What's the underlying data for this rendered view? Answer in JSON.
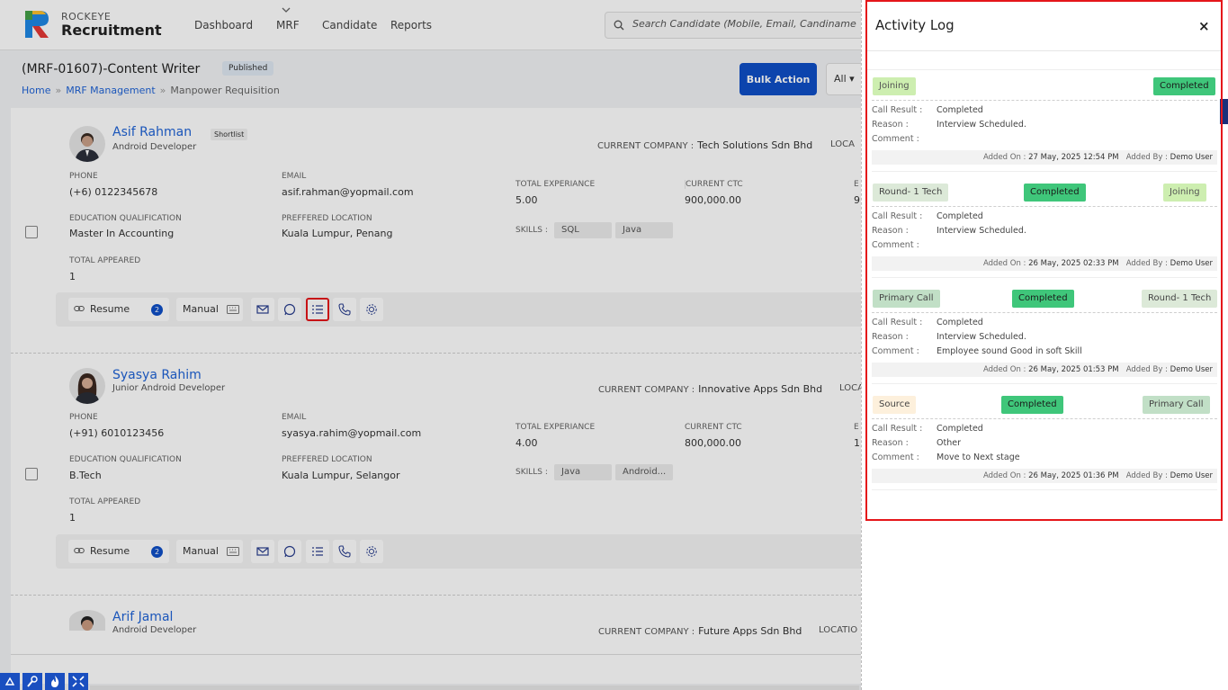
{
  "header": {
    "brand_top": "ROCKEYE",
    "brand_name": "Recruitment",
    "nav": [
      "Dashboard",
      "MRF",
      "Candidate",
      "Reports"
    ],
    "search_placeholder": "Search Candidate (Mobile, Email, Candiname"
  },
  "page": {
    "title": "(MRF-01607)-Content Writer",
    "status": "Published",
    "breadcrumb": [
      "Home",
      "MRF Management",
      "Manpower Requisition"
    ],
    "bulk_action": "Bulk Action",
    "filter": "All"
  },
  "labels": {
    "phone": "PHONE",
    "email": "EMAIL",
    "total_exp": "TOTAL EXPERIANCE",
    "ctc": "CURRENT CTC",
    "edu": "EDUCATION QUALIFICATION",
    "loc": "PREFFERED LOCATION",
    "skills": "SKILLS :",
    "appeared": "TOTAL APPEARED",
    "current_company": "CURRENT COMPANY :",
    "resume": "Resume",
    "manual": "Manual"
  },
  "candidates": [
    {
      "name": "Asif Rahman",
      "tag": "Shortlist",
      "role": "Android Developer",
      "company": "Tech Solutions Sdn Bhd",
      "location_cut": "LOCA",
      "phone": "(+6) 0122345678",
      "email": "asif.rahman@yopmail.com",
      "exp": "5.00",
      "ctc": "900,000.00",
      "ex_cut": "E",
      "ex_val_cut": "9",
      "edu": "Master In Accounting",
      "loc": "Kuala Lumpur, Penang",
      "skills": [
        "SQL",
        "Java"
      ],
      "appeared": "1",
      "resume_count": "2"
    },
    {
      "name": "Syasya Rahim",
      "tag": "",
      "role": "Junior Android Developer",
      "company": "Innovative Apps Sdn Bhd",
      "location_cut": "LOCA",
      "phone": "(+91) 6010123456",
      "email": "syasya.rahim@yopmail.com",
      "exp": "4.00",
      "ctc": "800,000.00",
      "ex_cut": "E",
      "ex_val_cut": "1,",
      "edu": "B.Tech",
      "loc": "Kuala Lumpur, Selangor",
      "skills": [
        "Java",
        "Android..."
      ],
      "appeared": "1",
      "resume_count": "2"
    },
    {
      "name": "Arif Jamal",
      "tag": "",
      "role": "Android Developer",
      "company": "Future Apps Sdn Bhd",
      "location_cut": "LOCATIO"
    }
  ],
  "activity": {
    "title": "Activity Log",
    "close": "×",
    "labels": {
      "call_result": "Call Result :",
      "reason": "Reason :",
      "comment": "Comment :",
      "added_on": "Added On :",
      "added_by": "Added By :"
    },
    "entries": [
      {
        "from": "Joining",
        "status": "Completed",
        "to": "",
        "call_result": "Completed",
        "reason": "Interview Scheduled.",
        "comment": "",
        "added_on": "27 May, 2025 12:54 PM",
        "added_by": "Demo User"
      },
      {
        "from": "Round- 1 Tech",
        "status": "Completed",
        "to": "Joining",
        "call_result": "Completed",
        "reason": "Interview Scheduled.",
        "comment": "",
        "added_on": "26 May, 2025 02:33 PM",
        "added_by": "Demo User"
      },
      {
        "from": "Primary Call",
        "status": "Completed",
        "to": "Round- 1 Tech",
        "call_result": "Completed",
        "reason": "Interview Scheduled.",
        "comment": "Employee sound Good in soft Skill",
        "added_on": "26 May, 2025 01:53 PM",
        "added_by": "Demo User"
      },
      {
        "from": "Source",
        "status": "Completed",
        "to": "Primary Call",
        "call_result": "Completed",
        "reason": "Other",
        "comment": "Move to Next stage",
        "added_on": "26 May, 2025 01:36 PM",
        "added_by": "Demo User"
      }
    ]
  },
  "colors": {
    "accent": "#0e4fc7",
    "link": "#1f63d6",
    "completed": "#3fc67a",
    "highlight": "#e5161a"
  }
}
